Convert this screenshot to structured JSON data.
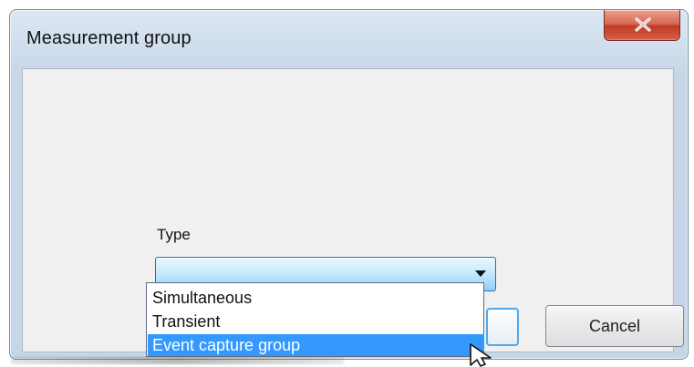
{
  "window": {
    "title": "Measurement group",
    "close_icon": "close-icon"
  },
  "form": {
    "type_label": "Type",
    "type_value": "",
    "dropdown_icon": "chevron-down-icon"
  },
  "buttons": {
    "ok_label": "",
    "cancel_label": "Cancel"
  },
  "dropdown": {
    "options": [
      "Simultaneous",
      "Transient",
      "Event capture group"
    ],
    "selected_index": 2
  },
  "cursor": {
    "icon": "mouse-cursor-icon"
  },
  "colors": {
    "accent_blue": "#3399ff",
    "close_red": "#c9412a",
    "select_blue": "#8fd0fb"
  }
}
